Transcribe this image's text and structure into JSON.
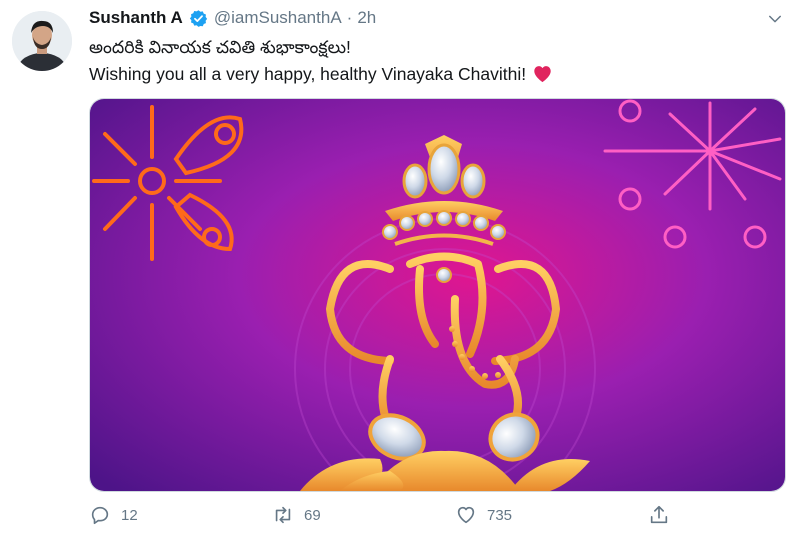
{
  "tweet": {
    "author": {
      "name": "Sushanth A",
      "handle": "@iamSushanthA",
      "time": "2h",
      "verified": true
    },
    "text_line1": "అందరికి వినాయక చవితి శుభాకాంక్షలు!",
    "text_line2": "Wishing you all a very happy, healthy Vinayaka Chavithi!",
    "emoji": "red-heart",
    "media": {
      "icon": "ganesha-illustration",
      "colors": {
        "background": "#6a1a9a",
        "accent": "#ff2fbf",
        "gold": "#f5a93a"
      }
    },
    "actions": {
      "reply_count": "12",
      "retweet_count": "69",
      "like_count": "735"
    }
  },
  "colors": {
    "verified": "#1da1f2",
    "muted": "#657786",
    "heart": "#e0245e"
  }
}
